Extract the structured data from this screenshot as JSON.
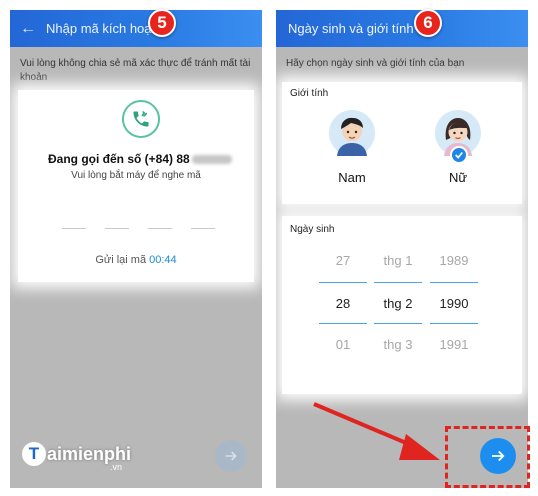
{
  "step5": {
    "badge": "5",
    "header_title": "Nhập mã kích hoạt",
    "info_text": "Vui lòng không chia sẻ mã xác thực để tránh mất tài khoản",
    "calling_text": "Đang gọi đến số (+84) 88",
    "pickup_text": "Vui lòng bắt máy để nghe mã",
    "resend_label": "Gửi lại mã",
    "resend_timer": "00:44",
    "icons": {
      "back": "back-arrow-icon",
      "call": "incoming-call-icon",
      "next": "arrow-right-icon"
    }
  },
  "step6": {
    "badge": "6",
    "header_title": "Ngày sinh và giới tính",
    "info_text": "Hãy chọn ngày sinh và giới tính của bạn",
    "gender_label": "Giới tính",
    "male_label": "Nam",
    "female_label": "Nữ",
    "selected_gender": "Nữ",
    "dob_label": "Ngày sinh",
    "day_options": [
      "27",
      "28",
      "01"
    ],
    "month_options": [
      "thg 1",
      "thg 2",
      "thg 3"
    ],
    "year_options": [
      "1989",
      "1990",
      "1991"
    ],
    "selected": {
      "day": "28",
      "month": "thg 2",
      "year": "1990"
    },
    "icons": {
      "male": "male-avatar-icon",
      "female": "female-avatar-icon",
      "check": "check-icon",
      "next": "arrow-right-icon"
    }
  },
  "watermark": {
    "letter": "T",
    "name": "aimienphi",
    "suffix": ".vn"
  },
  "colors": {
    "header": "#2a7be4",
    "badge": "#e8251d",
    "accent": "#1d8ef0",
    "highlight": "#e0241f"
  }
}
